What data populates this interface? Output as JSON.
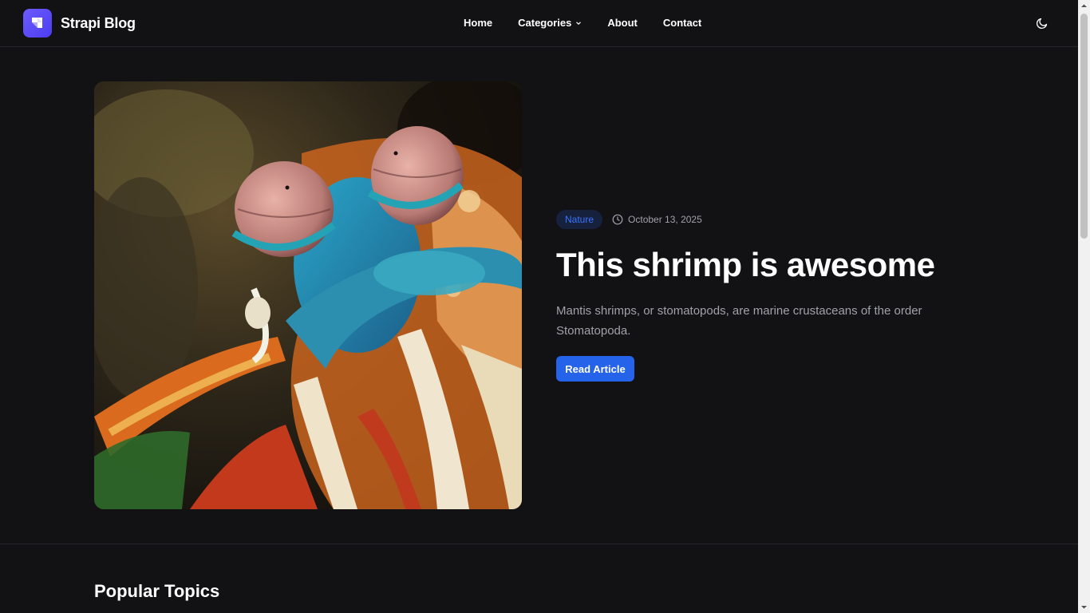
{
  "header": {
    "logo_text": "Strapi Blog",
    "nav": {
      "home": "Home",
      "categories": "Categories",
      "about": "About",
      "contact": "Contact"
    },
    "theme_toggle_icon": "moon-icon"
  },
  "hero": {
    "category": "Nature",
    "date": "October 13, 2025",
    "title": "This shrimp is awesome",
    "excerpt": "Mantis shrimps, or stomatopods, are marine crustaceans of the order Stomatopoda.",
    "cta": "Read Article",
    "image_icon": "mantis-shrimp-photo"
  },
  "popular": {
    "title": "Popular Topics"
  },
  "colors": {
    "background": "#121214",
    "accent": "#2563eb",
    "badge_bg": "#16213d",
    "badge_text": "#3b73ff",
    "muted_text": "#a1a1aa",
    "logo": "#5b4cf5"
  }
}
